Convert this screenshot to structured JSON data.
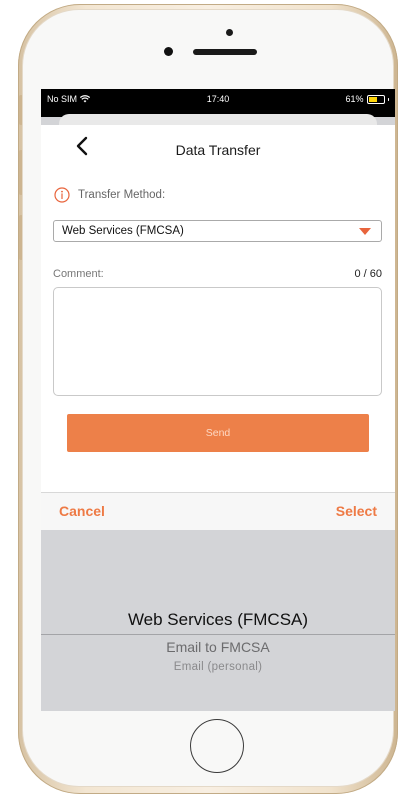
{
  "status_bar": {
    "carrier": "No SIM",
    "time": "17:40",
    "battery_percent": "61%",
    "battery_level": 0.61,
    "battery_color": "#ffd60a"
  },
  "header": {
    "title": "Data Transfer",
    "back_icon": "chevron-left-icon"
  },
  "form": {
    "method_label": "Transfer Method:",
    "info_icon": "info-circle-icon",
    "selected_method": "Web Services (FMCSA)",
    "comment_label": "Comment:",
    "comment_counter": "0 / 60",
    "comment_value": "",
    "send_label": "Send"
  },
  "picker": {
    "cancel_label": "Cancel",
    "select_label": "Select",
    "options": [
      {
        "label": "Web Services (FMCSA)"
      },
      {
        "label": "Email to FMCSA"
      },
      {
        "label": "Email (personal)"
      }
    ]
  },
  "colors": {
    "accent": "#ed8049",
    "accent_text": "#ee7a45",
    "caret": "#e8643c"
  }
}
